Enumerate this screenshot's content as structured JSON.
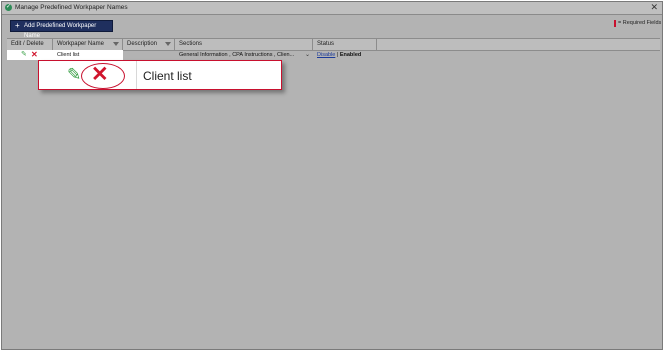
{
  "window": {
    "title": "Manage Predefined Workpaper Names",
    "close_glyph": "✕",
    "title_icon": "✓"
  },
  "toolbar": {
    "add_button_label": "Add Predefined Workpaper Name",
    "add_icon": "+"
  },
  "legend": {
    "required_fields": "= Required Fields",
    "required_color": "#c8102e"
  },
  "grid": {
    "columns": [
      "Edit / Delete",
      "Workpaper Name",
      "Description",
      "Sections",
      "Status"
    ],
    "rows": [
      {
        "workpaper_name": "Client list",
        "description": "",
        "sections": "General Information , CPA Instructions , Clien...",
        "status_action": "Disable",
        "status_separator": "|",
        "status_value": "Enabled"
      }
    ]
  },
  "zoom_callout": {
    "label": "Client list",
    "edit_icon": "pencil-icon",
    "delete_icon": "delete-x-icon"
  },
  "colors": {
    "header_button": "#1f2f5e",
    "edit_green": "#3aa047",
    "delete_red": "#d0142c",
    "overlay": "#b3b3b3"
  }
}
